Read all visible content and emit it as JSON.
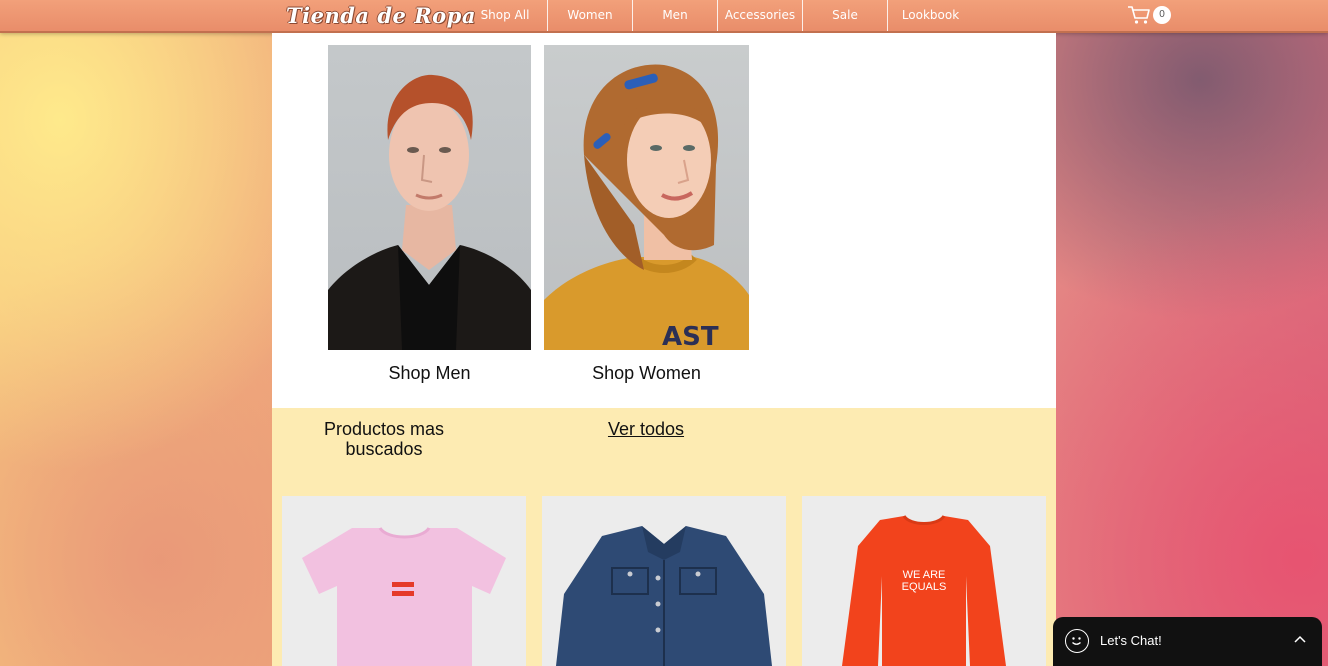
{
  "header": {
    "logo": "Tienda de Ropa",
    "nav": [
      "Shop All",
      "Women",
      "Men",
      "Accessories",
      "Sale",
      "Lookbook"
    ],
    "cart_count": "0"
  },
  "hero": {
    "shop_men": "Shop Men",
    "shop_women": "Shop Women"
  },
  "products_section": {
    "title": "Productos mas buscados",
    "view_all": "Ver todos",
    "sweatshirt_print": "WE ARE EQUALS"
  },
  "chat": {
    "label": "Let's Chat!"
  },
  "colors": {
    "header": "#ee9872",
    "panel_yellow": "#fdebb2",
    "chat_bg": "#111111"
  }
}
